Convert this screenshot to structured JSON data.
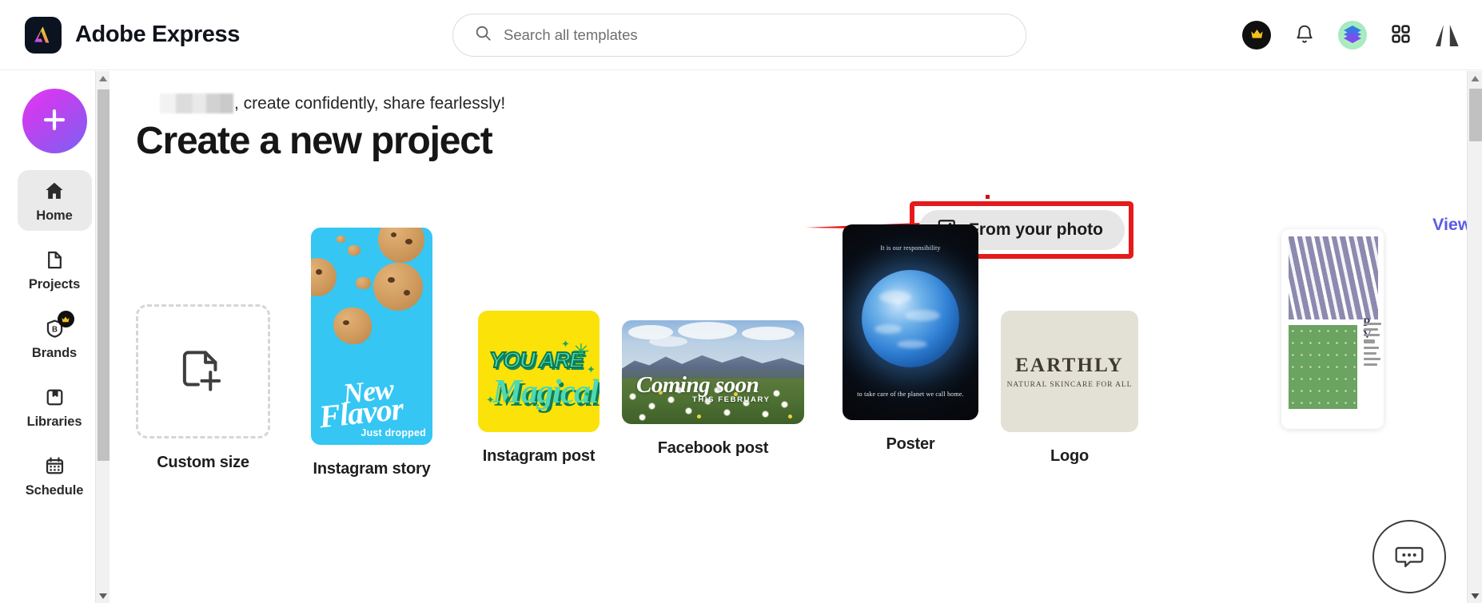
{
  "header": {
    "brand_name": "Adobe Express",
    "brand_icon": "adobe-express-logo-icon",
    "search": {
      "placeholder": "Search all templates",
      "value": "",
      "icon": "search-icon"
    },
    "actions": [
      {
        "name": "premium-crown-button",
        "icon": "crown-icon"
      },
      {
        "name": "notifications-button",
        "icon": "bell-icon"
      },
      {
        "name": "account-avatar-button",
        "icon": "layers-stack-avatar-icon"
      },
      {
        "name": "app-switcher-button",
        "icon": "grid-apps-icon"
      },
      {
        "name": "adobe-logo",
        "icon": "adobe-a-logo-icon"
      }
    ]
  },
  "sidebar": {
    "create_button": {
      "label": "+",
      "icon": "plus-icon"
    },
    "items": [
      {
        "label": "Home",
        "icon": "home-icon",
        "active": true,
        "badge": false
      },
      {
        "label": "Projects",
        "icon": "document-icon",
        "active": false,
        "badge": false
      },
      {
        "label": "Brands",
        "icon": "brand-b-icon",
        "active": false,
        "badge": true
      },
      {
        "label": "Libraries",
        "icon": "library-icon",
        "active": false,
        "badge": false
      },
      {
        "label": "Schedule",
        "icon": "calendar-icon",
        "active": false,
        "badge": false
      }
    ]
  },
  "main": {
    "greeting_suffix": ", create confidently, share fearlessly!",
    "greeting_name_redacted": true,
    "page_title": "Create a new project",
    "from_photo_button": {
      "label": "From your photo",
      "icon": "image-plus-icon",
      "highlighted": true
    },
    "view_all_link": {
      "label": "View all",
      "icon": "chevron-right-icon"
    },
    "carousel_next": {
      "icon": "chevron-right-icon"
    },
    "chat_button": {
      "icon": "chat-bubble-icon"
    }
  },
  "templates": [
    {
      "label": "Custom size",
      "kind": "custom",
      "icon": "document-plus-icon"
    },
    {
      "label": "Instagram story",
      "kind": "cookies",
      "line1": "New",
      "line2": "Flavor",
      "line3": "Just dropped"
    },
    {
      "label": "Instagram post",
      "kind": "magical",
      "line1": "YOU ARE",
      "line2": "Magical"
    },
    {
      "label": "Facebook post",
      "kind": "facebook",
      "line1": "Coming soon",
      "line2": "THIS FEBRUARY"
    },
    {
      "label": "Poster",
      "kind": "poster",
      "line1": "It is our responsibility",
      "line2": "to take care of the planet we call home."
    },
    {
      "label": "Logo",
      "kind": "logo",
      "line1": "EARTHLY",
      "line2": "NATURAL SKINCARE FOR ALL"
    }
  ],
  "annotation": {
    "highlight_color": "#E51A1A",
    "arrow": "red-arrow-pointing-right",
    "target": "From your photo"
  },
  "colors": {
    "accent_link": "#5B5BE6",
    "highlight_red": "#E51A1A",
    "brand_dark": "#0B1220"
  }
}
